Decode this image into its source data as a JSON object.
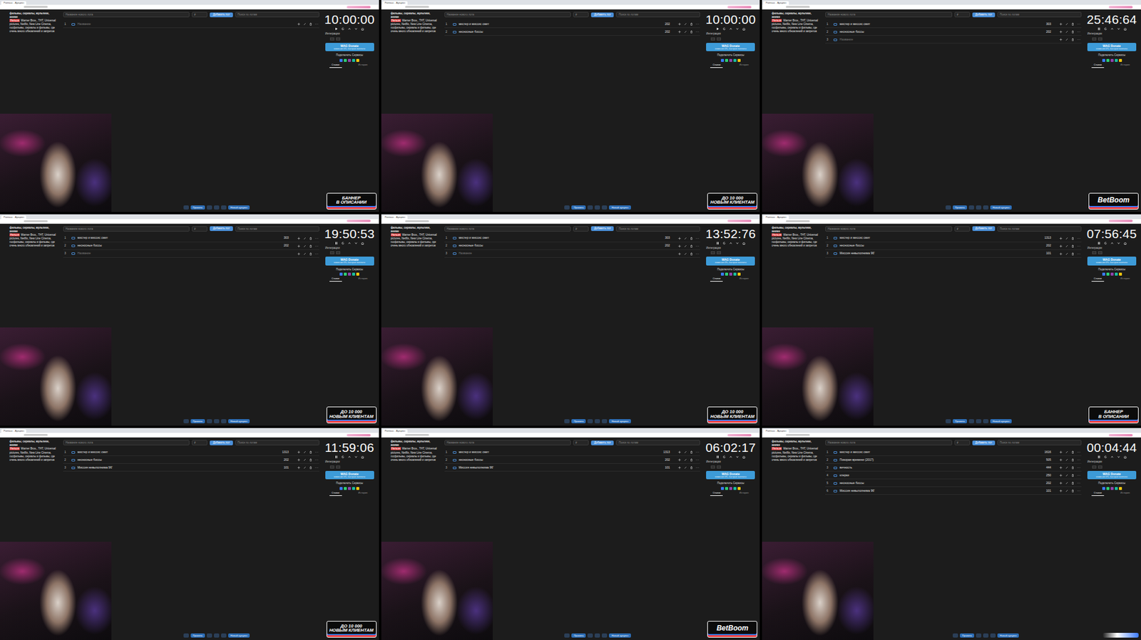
{
  "app": {
    "browser_tab": "Pointauc - Аукцион",
    "header_title": "фильмы, сериалы, мультики, аниме",
    "forbidden_tag": "Нельзя",
    "forbidden_text": "Warner Bros., ТНТ, Universal pictures, Netflix, New Line Cinema, госфильмы, сериалы и фильмы, где очень много обновлений и запретов",
    "new_lot_placeholder": "Название нового лота",
    "amount_placeholder": "₽",
    "add_button": "Добавить лот",
    "search_placeholder": "Поиск по лотам",
    "integrations": "Интеграции",
    "donate_button": "WAG Donate",
    "donate_sub": "комиссия 0%, быстрые выплаты",
    "connect": "Подключить Сервисы",
    "tabs": [
      {
        "label": "Ставки",
        "selected": true
      },
      {
        "label": "История",
        "selected": false
      }
    ],
    "toolbar": {
      "rules": "Правила",
      "new_auction": "Новый аукцион"
    }
  },
  "frames": [
    {
      "timer": "10:00:00",
      "running": false,
      "lots": [
        {
          "num": "1",
          "name": "Название",
          "amount": "",
          "placeholder": true
        }
      ],
      "banner": {
        "kind": "text",
        "lines": [
          "БАННЕР",
          "В ОПИСАНИИ"
        ]
      }
    },
    {
      "timer": "10:00:00",
      "running": false,
      "lots": [
        {
          "num": "1",
          "name": "мистер и миссис смит",
          "amount": "202",
          "placeholder": false
        },
        {
          "num": "2",
          "name": "несносные боссы",
          "amount": "202",
          "placeholder": false
        }
      ],
      "banner": {
        "kind": "text",
        "lines": [
          "ДО 10 000",
          "НОВЫМ КЛИЕНТАМ"
        ]
      }
    },
    {
      "timer": "25:46:64",
      "running": true,
      "lots": [
        {
          "num": "1",
          "name": "мистер и миссис смит",
          "amount": "303",
          "placeholder": false
        },
        {
          "num": "2",
          "name": "несносные боссы",
          "amount": "202",
          "placeholder": false
        },
        {
          "num": "3",
          "name": "Название",
          "amount": "",
          "placeholder": true
        }
      ],
      "banner": {
        "kind": "logo",
        "lines": [
          "BetBoom"
        ]
      }
    },
    {
      "timer": "19:50:53",
      "running": true,
      "lots": [
        {
          "num": "1",
          "name": "мистер и миссис смит",
          "amount": "303",
          "placeholder": false
        },
        {
          "num": "2",
          "name": "несносные боссы",
          "amount": "202",
          "placeholder": false
        },
        {
          "num": "3",
          "name": "Название",
          "amount": "",
          "placeholder": true
        }
      ],
      "banner": {
        "kind": "text",
        "lines": [
          "ДО 10 000",
          "НОВЫМ КЛИЕНТАМ"
        ]
      }
    },
    {
      "timer": "13:52:76",
      "running": true,
      "lots": [
        {
          "num": "1",
          "name": "мистер и миссис смит",
          "amount": "303",
          "placeholder": false
        },
        {
          "num": "2",
          "name": "несносные боссы",
          "amount": "202",
          "placeholder": false
        },
        {
          "num": "3",
          "name": "Название",
          "amount": "",
          "placeholder": true
        }
      ],
      "banner": {
        "kind": "text",
        "lines": [
          "ДО 10 000",
          "НОВЫМ КЛИЕНТАМ"
        ]
      }
    },
    {
      "timer": "07:56:45",
      "running": true,
      "lots": [
        {
          "num": "1",
          "name": "мистер и миссис смит",
          "amount": "1313",
          "placeholder": false
        },
        {
          "num": "2",
          "name": "несносные боссы",
          "amount": "202",
          "placeholder": false
        },
        {
          "num": "3",
          "name": "Миссия невыполнима 96'",
          "amount": "101",
          "placeholder": false
        }
      ],
      "banner": {
        "kind": "text",
        "lines": [
          "БАННЕР",
          "В ОПИСАНИИ"
        ]
      }
    },
    {
      "timer": "11:59:06",
      "running": true,
      "lots": [
        {
          "num": "1",
          "name": "мистер и миссис смит",
          "amount": "1313",
          "placeholder": false
        },
        {
          "num": "2",
          "name": "несносные боссы",
          "amount": "202",
          "placeholder": false
        },
        {
          "num": "3",
          "name": "Миссия невыполнима 96'",
          "amount": "101",
          "placeholder": false
        }
      ],
      "banner": {
        "kind": "text",
        "lines": [
          "ДО 10 000",
          "НОВЫМ КЛИЕНТАМ"
        ]
      }
    },
    {
      "timer": "06:02:17",
      "running": true,
      "lots": [
        {
          "num": "1",
          "name": "мистер и миссис смит",
          "amount": "1313",
          "placeholder": false
        },
        {
          "num": "2",
          "name": "несносные боссы",
          "amount": "202",
          "placeholder": false
        },
        {
          "num": "3",
          "name": "Миссия невыполнима 96'",
          "amount": "101",
          "placeholder": false
        }
      ],
      "banner": {
        "kind": "logo",
        "lines": [
          "BetBoom"
        ]
      }
    },
    {
      "timer": "00:04:44",
      "running": true,
      "lots": [
        {
          "num": "1",
          "name": "мистер и миссис смит",
          "amount": "1616",
          "placeholder": false
        },
        {
          "num": "2",
          "name": "Покорая времени (2017)",
          "amount": "505",
          "placeholder": false
        },
        {
          "num": "3",
          "name": "вечность",
          "amount": "444",
          "placeholder": false
        },
        {
          "num": "4",
          "name": "клерки",
          "amount": "250",
          "placeholder": false
        },
        {
          "num": "5",
          "name": "несносные боссы",
          "amount": "202",
          "placeholder": false
        },
        {
          "num": "6",
          "name": "Миссия невыполнима 96'",
          "amount": "101",
          "placeholder": false
        }
      ],
      "banner": {
        "kind": "partial",
        "lines": []
      }
    }
  ]
}
